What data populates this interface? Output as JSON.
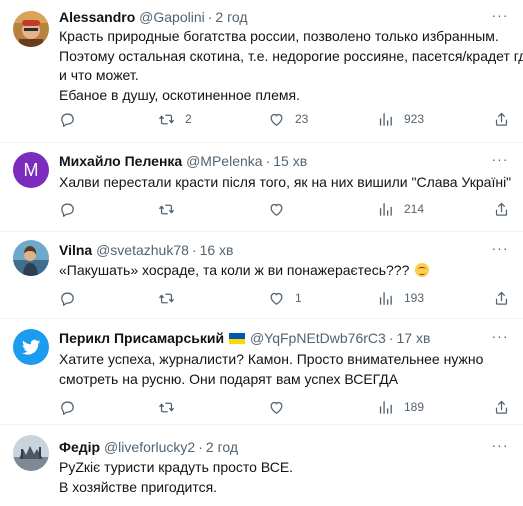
{
  "tweets": [
    {
      "name": "Alessandro",
      "handle": "@Gapolini",
      "time": "2 год",
      "lines": [
        "Красть природные богатства россии, позволено только избранным.",
        "Поэтому остальная скотина, т.е. недорогие россияне, пасется/крадет где",
        "и что может.",
        "Ебаное в душу, оскотиненное племя."
      ],
      "replies": "",
      "retweets": "2",
      "likes": "23",
      "views": "923"
    },
    {
      "name": "Михайло Пеленка",
      "handle": "@MPelenka",
      "time": "15 хв",
      "avatar_letter": "M",
      "lines": [
        "Халви перестали красти після того, як на них вишили \"Слава Україні\""
      ],
      "replies": "",
      "retweets": "",
      "likes": "",
      "views": "214"
    },
    {
      "name": "Vilna",
      "handle": "@svetazhuk78",
      "time": "16 хв",
      "lines": [
        "«Пакушать» хосраде, та коли ж ви понажераєтесь???"
      ],
      "replies": "",
      "retweets": "",
      "likes": "1",
      "views": "193"
    },
    {
      "name": "Перикл Присамарський",
      "handle": "@YqFpNEtDwb76rC3",
      "time": "17 хв",
      "lines": [
        "Хатите успеха, журналисти? Камон. Просто внимательнее нужно",
        "смотреть на русню. Они подарят вам успех ВСЕГДА"
      ],
      "replies": "",
      "retweets": "",
      "likes": "",
      "views": "189"
    },
    {
      "name": "Федір",
      "handle": "@liveforlucky2",
      "time": "2 год",
      "lines": [
        "РуZкіє туристи крадуть просто ВСЕ.",
        "В хозяйстве пригодится."
      ]
    }
  ],
  "colors": {
    "text": "#0f1419",
    "muted": "#536471",
    "divider": "#eff3f4",
    "avatar_purple": "#7b2cbf",
    "twitter_blue": "#1d9bf0"
  },
  "icons": [
    "more-icon",
    "reply-icon",
    "retweet-icon",
    "like-icon",
    "views-icon",
    "share-icon",
    "twitter-bird-icon",
    "ukraine-flag-icon",
    "rolling-eyes-emoji"
  ]
}
